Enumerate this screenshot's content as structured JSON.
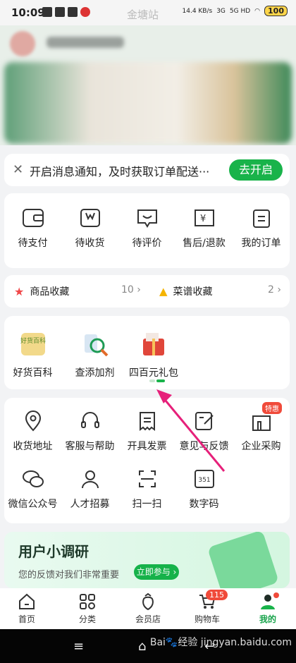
{
  "status": {
    "time": "10:09",
    "center": "金塘站",
    "speed": "14.4 KB/s",
    "net1": "3G",
    "net2": "5G HD",
    "battery": "100"
  },
  "notify": {
    "close": "✕",
    "text": "开启消息通知，及时获取订单配送···",
    "button": "去开启"
  },
  "orders": [
    {
      "label": "待支付",
      "icon": "wallet-icon"
    },
    {
      "label": "待收货",
      "icon": "package-icon"
    },
    {
      "label": "待评价",
      "icon": "review-icon"
    },
    {
      "label": "售后/退款",
      "icon": "refund-icon"
    },
    {
      "label": "我的订单",
      "icon": "clipboard-icon"
    }
  ],
  "favs": {
    "goods_label": "商品收藏",
    "goods_count": "10",
    "goods_arrow": "›",
    "recipes_label": "菜谱收藏",
    "recipes_count": "2",
    "recipes_arrow": "›"
  },
  "tools": [
    {
      "label": "好货百科",
      "icon": "goods-encyclopedia-icon",
      "icon_text": "好货百科"
    },
    {
      "label": "查添加剂",
      "icon": "additive-check-icon"
    },
    {
      "label": "四百元礼包",
      "icon": "gift-pack-icon"
    }
  ],
  "services": [
    {
      "label": "收货地址",
      "icon": "location-icon"
    },
    {
      "label": "客服与帮助",
      "icon": "headset-icon"
    },
    {
      "label": "开具发票",
      "icon": "invoice-icon"
    },
    {
      "label": "意见与反馈",
      "icon": "feedback-icon"
    },
    {
      "label": "企业采购",
      "icon": "enterprise-icon",
      "badge": "特惠"
    },
    {
      "label": "微信公众号",
      "icon": "wechat-icon"
    },
    {
      "label": "人才招募",
      "icon": "recruit-icon"
    },
    {
      "label": "扫一扫",
      "icon": "scan-icon"
    },
    {
      "label": "数字码",
      "icon": "number-code-icon",
      "icon_text": "351"
    }
  ],
  "survey": {
    "title": "用户小调研",
    "subtitle": "您的反馈对我们非常重要",
    "button": "立即参与 ›"
  },
  "tabs": [
    {
      "label": "首页",
      "icon": "home-icon"
    },
    {
      "label": "分类",
      "icon": "category-icon"
    },
    {
      "label": "会员店",
      "icon": "vip-store-icon"
    },
    {
      "label": "购物车",
      "icon": "cart-icon",
      "badge": "115"
    },
    {
      "label": "我的",
      "icon": "profile-icon"
    }
  ],
  "watermark": "Bai🐾经验 jingyan.baidu.com",
  "colors": {
    "brand_green": "#19b34a",
    "badge_red": "#f04a3a",
    "arrow": "#e6207a"
  }
}
